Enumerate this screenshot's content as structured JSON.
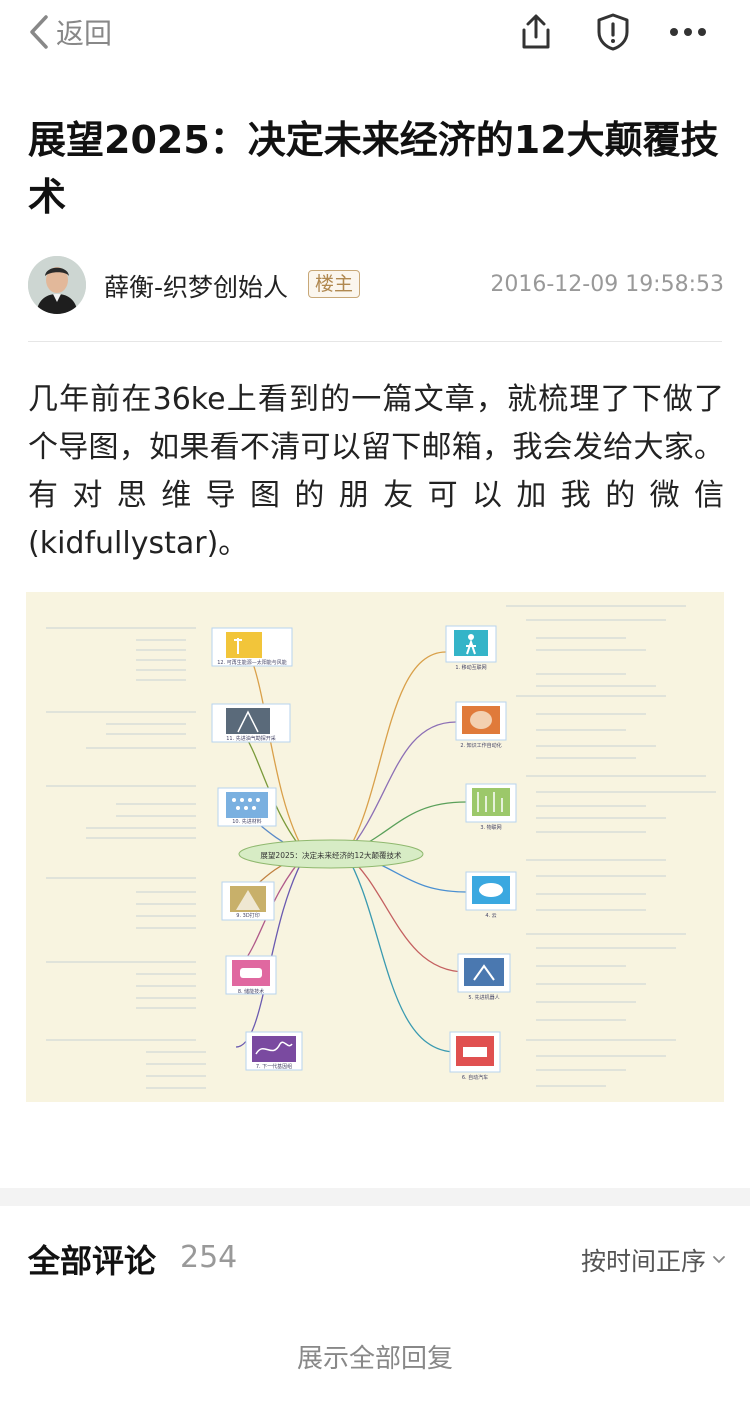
{
  "navbar": {
    "back_label": "返回",
    "icons": [
      "share-icon",
      "shield-alert-icon",
      "more-dots-icon"
    ]
  },
  "post": {
    "title": "展望2025：决定未来经济的12大颠覆技术",
    "author": "薛衡-织梦创始人",
    "badge": "楼主",
    "time": "2016-12-09 19:58:53",
    "body": "几年前在36ke上看到的一篇文章，就梳理了下做了个导图，如果看不清可以留下邮箱，我会发给大家。有对思维导图的朋友可以加我的微信(kidfullystar)。"
  },
  "mindmap": {
    "center_label": "展望2025：决定未来经济的12大颠覆技术",
    "nodes_right": [
      "1. 移动互联网",
      "2. 知识工作自动化",
      "3. 物联网",
      "4. 云",
      "5. 先进机器人",
      "6. 自动汽车"
    ],
    "nodes_left": [
      "12. 可再生能源—太阳能与风能",
      "11. 先进油气勘探开采",
      "10. 先进材料",
      "9. 3D打印",
      "8. 储能技术",
      "7. 下一代基因组"
    ]
  },
  "comments": {
    "title": "全部评论",
    "count": "254",
    "sort_label": "按时间正序",
    "show_all": "展示全部回复"
  }
}
